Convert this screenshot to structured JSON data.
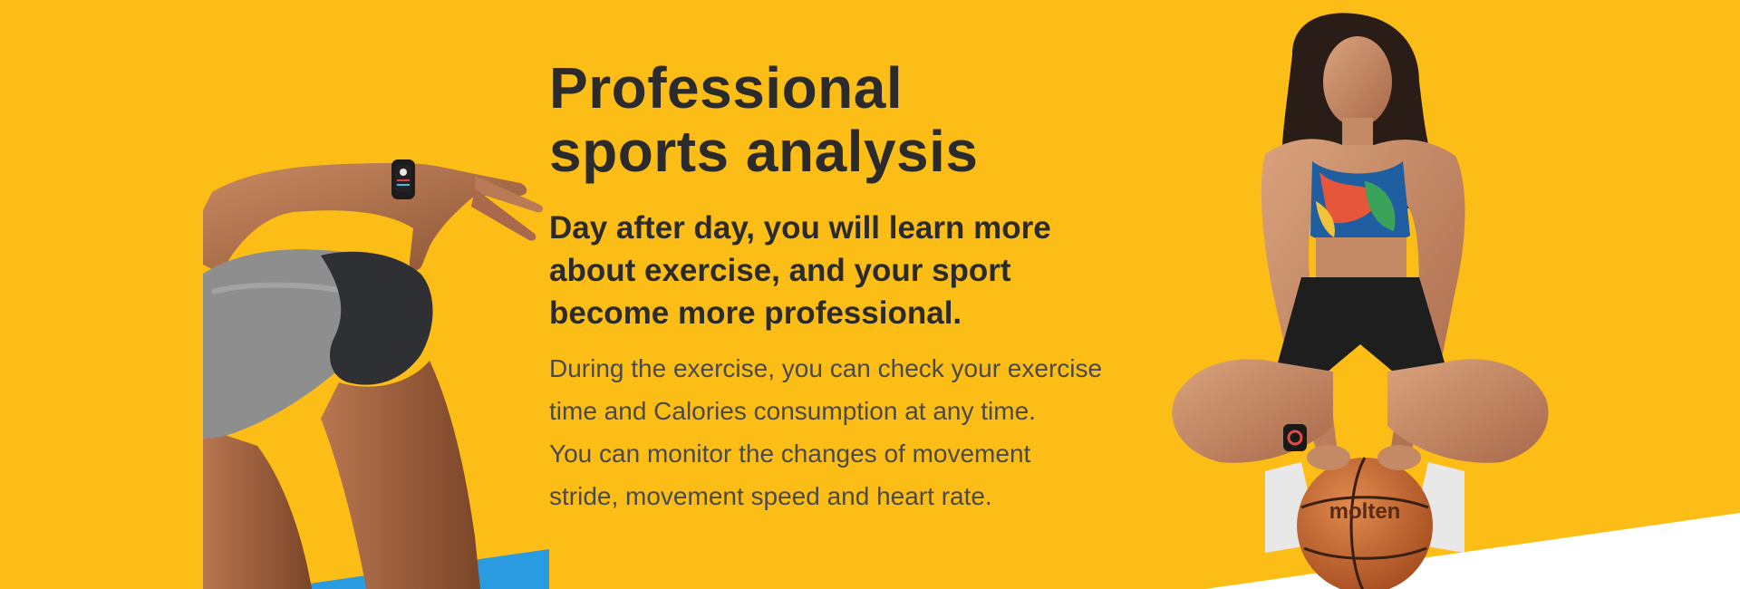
{
  "headline": {
    "line1": "Professional",
    "line2": "sports analysis"
  },
  "subheadline": {
    "line1": "Day after day, you will learn more",
    "line2": "about exercise, and your sport",
    "line3": "become more professional."
  },
  "body": {
    "line1": "During the exercise, you can check your exercise",
    "line2": "time and Calories consumption at any time.",
    "line3": "You can monitor the changes of movement",
    "line4": "stride, movement speed and heart rate."
  },
  "basketball_brand": "molten",
  "colors": {
    "background": "#fdbd17",
    "heading_text": "#2b2b2b",
    "body_text": "#4a4a4a",
    "accent_blue": "#2a9be0",
    "corner_white": "#ffffff"
  }
}
